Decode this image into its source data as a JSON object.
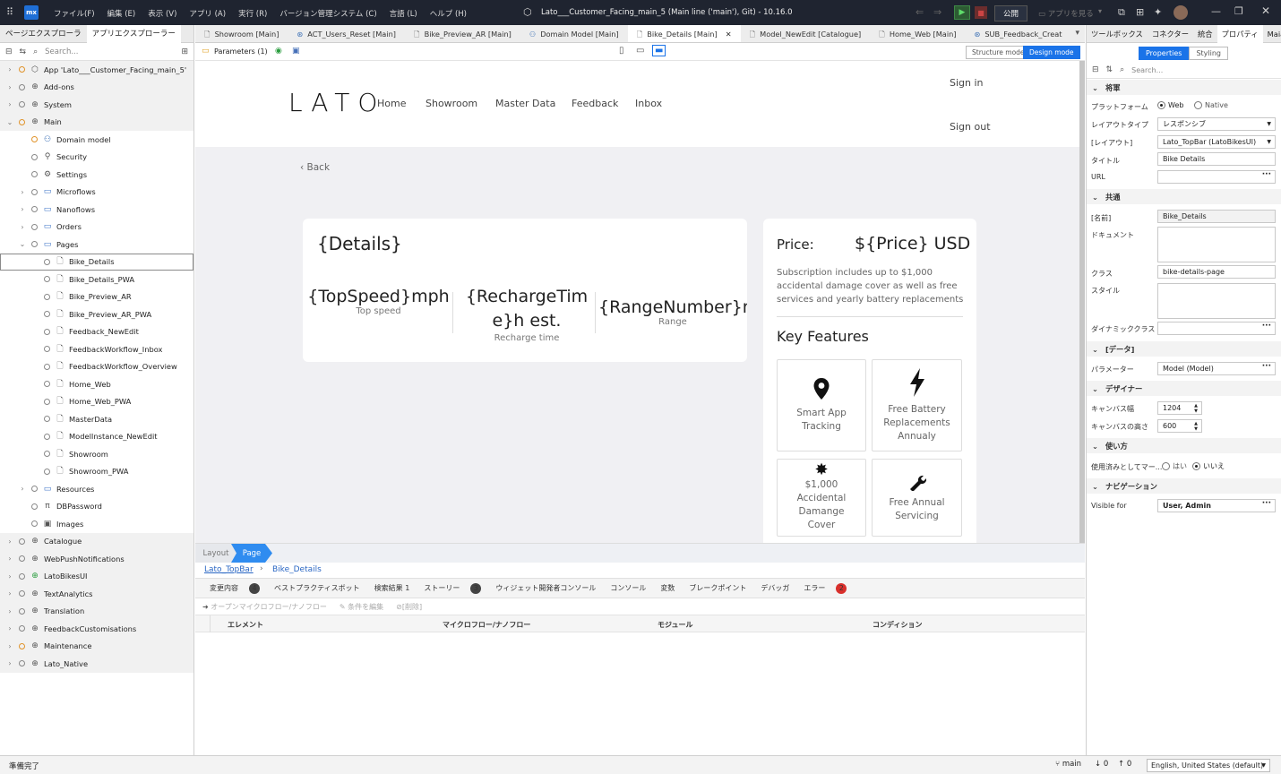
{
  "titlebar": {
    "menus": [
      "ファイル(F)",
      "編集 (E)",
      "表示 (V)",
      "アプリ (A)",
      "実行 (R)",
      "バージョン管理システム (C)",
      "言語 (L)",
      "ヘルプ (H)"
    ],
    "window_title": "Lato___Customer_Facing_main_5 (Main line ('main'), Git) - 10.16.0",
    "publish": "公開",
    "view_app": "アプリを見る",
    "logo": "mx"
  },
  "left": {
    "tabs": [
      "ページエクスプローラ",
      "アプリエクスプローラー"
    ],
    "search_placeholder": "Search...",
    "tree": [
      {
        "label": "App 'Lato___Customer_Facing_main_5'",
        "icon": "app-icon"
      },
      {
        "label": "Add-ons",
        "icon": "module-icon"
      },
      {
        "label": "System",
        "icon": "module-icon"
      },
      {
        "label": "Main",
        "icon": "module-icon"
      },
      {
        "label": "Domain model",
        "icon": "domain-model-icon"
      },
      {
        "label": "Security",
        "icon": "key-icon"
      },
      {
        "label": "Settings",
        "icon": "gear-icon"
      },
      {
        "label": "Microflows",
        "icon": "folder-icon"
      },
      {
        "label": "Nanoflows",
        "icon": "folder-icon"
      },
      {
        "label": "Orders",
        "icon": "folder-icon"
      },
      {
        "label": "Pages",
        "icon": "folder-icon"
      },
      {
        "label": "Bike_Details",
        "icon": "page-icon"
      },
      {
        "label": "Bike_Details_PWA",
        "icon": "page-icon"
      },
      {
        "label": "Bike_Preview_AR",
        "icon": "page-icon"
      },
      {
        "label": "Bike_Preview_AR_PWA",
        "icon": "page-icon"
      },
      {
        "label": "Feedback_NewEdit",
        "icon": "page-icon"
      },
      {
        "label": "FeedbackWorkflow_Inbox",
        "icon": "page-icon"
      },
      {
        "label": "FeedbackWorkflow_Overview",
        "icon": "page-icon"
      },
      {
        "label": "Home_Web",
        "icon": "page-icon"
      },
      {
        "label": "Home_Web_PWA",
        "icon": "page-icon"
      },
      {
        "label": "MasterData",
        "icon": "page-icon"
      },
      {
        "label": "ModelInstance_NewEdit",
        "icon": "page-icon"
      },
      {
        "label": "Showroom",
        "icon": "page-icon"
      },
      {
        "label": "Showroom_PWA",
        "icon": "page-icon"
      },
      {
        "label": "Resources",
        "icon": "folder-icon"
      },
      {
        "label": "DBPassword",
        "icon": "constant-icon"
      },
      {
        "label": "Images",
        "icon": "image-collection-icon"
      },
      {
        "label": "Catalogue",
        "icon": "module-icon"
      },
      {
        "label": "WebPushNotifications",
        "icon": "module-icon"
      },
      {
        "label": "LatoBikesUI",
        "icon": "module-icon"
      },
      {
        "label": "TextAnalytics",
        "icon": "module-icon"
      },
      {
        "label": "Translation",
        "icon": "module-icon"
      },
      {
        "label": "FeedbackCustomisations",
        "icon": "module-icon"
      },
      {
        "label": "Maintenance",
        "icon": "module-icon"
      },
      {
        "label": "Lato_Native",
        "icon": "module-icon"
      }
    ]
  },
  "doc_tabs": [
    {
      "label": "Showroom [Main]",
      "icon": "page-icon"
    },
    {
      "label": "ACT_Users_Reset [Main]",
      "icon": "microflow-icon"
    },
    {
      "label": "Bike_Preview_AR [Main]",
      "icon": "page-icon"
    },
    {
      "label": "Domain Model [Main]",
      "icon": "domain-model-icon"
    },
    {
      "label": "Bike_Details [Main]",
      "icon": "page-icon"
    },
    {
      "label": "Model_NewEdit [Catalogue]",
      "icon": "page-icon"
    },
    {
      "label": "Home_Web [Main]",
      "icon": "page-icon"
    },
    {
      "label": "SUB_Feedback_Creat",
      "icon": "microflow-icon"
    }
  ],
  "subbar": {
    "parameters": "Parameters (1)",
    "structure_mode": "Structure mode",
    "design_mode": "Design mode"
  },
  "site": {
    "logo": "LATO",
    "nav": [
      "Home",
      "Showroom",
      "Master Data",
      "Feedback",
      "Inbox"
    ],
    "sign_in": "Sign in",
    "sign_out": "Sign out",
    "back": "Back",
    "details": "{Details}",
    "stats": [
      {
        "value": "{TopSpeed}mph",
        "label": "Top speed"
      },
      {
        "value": "{RechargeTime}h est.",
        "label": "Recharge time"
      },
      {
        "value": "{RangeNumber}mi",
        "label": "Range"
      }
    ],
    "price_label": "Price:",
    "price_value": "${Price} USD",
    "price_note": "Subscription includes up to $1,000 accidental damage cover as well as free services and yearly battery replacements",
    "features_title": "Key Features",
    "features": [
      {
        "label": "Smart App Tracking",
        "icon": "map-pin-icon"
      },
      {
        "label": "Free Battery Replacements Annualy",
        "icon": "lightning-icon"
      },
      {
        "label": "$1,000 Accidental Damange Cover",
        "icon": "burst-icon"
      },
      {
        "label": "Free Annual Servicing",
        "icon": "wrench-icon"
      }
    ]
  },
  "bottom": {
    "crumb_layout": "Layout",
    "crumb_page": "Page",
    "link_layout": "Lato_TopBar",
    "link_page": "Bike_Details",
    "tabs": [
      {
        "label": "変更内容",
        "badge": "4"
      },
      {
        "label": "ベストプラクティスボット",
        "badge": ""
      },
      {
        "label": "検索結果 1",
        "badge": ""
      },
      {
        "label": "ストーリー",
        "badge": "3"
      },
      {
        "label": "ウィジェット開発者コンソール",
        "badge": ""
      },
      {
        "label": "コンソール",
        "badge": ""
      },
      {
        "label": "変数",
        "badge": ""
      },
      {
        "label": "ブレークポイント",
        "badge": ""
      },
      {
        "label": "デバッガ",
        "badge": ""
      },
      {
        "label": "エラー",
        "badge": "2"
      }
    ],
    "toolbar": [
      "オープンマイクロフロー/ナノフロー",
      "条件を編集",
      "[削除]"
    ],
    "columns": [
      "エレメント",
      "マイクロフロー/ナノフロー",
      "モジュール",
      "コンディション"
    ]
  },
  "right": {
    "tabs": [
      "ツールボックス",
      "コネクター",
      "統合",
      "プロパティ",
      "Maia"
    ],
    "toggle": [
      "Properties",
      "Styling"
    ],
    "search_placeholder": "Search...",
    "sections": {
      "general": "将軍",
      "common": "共通",
      "data": "[データ]",
      "designer": "デザイナー",
      "usage": "使い方",
      "navigation": "ナビゲーション"
    },
    "platform_label": "プラットフォーム",
    "platform_web": "Web",
    "platform_native": "Native",
    "layout_type_label": "レイアウトタイプ",
    "layout_type": "レスポンシブ",
    "layout_label": "[レイアウト]",
    "layout": "Lato_TopBar (LatoBikesUI)",
    "title_label": "タイトル",
    "title": "Bike Details",
    "url_label": "URL",
    "name_label": "[名前]",
    "name": "Bike_Details",
    "doc_label": "ドキュメント",
    "class_label": "クラス",
    "class": "bike-details-page",
    "style_label": "スタイル",
    "dynclass_label": "ダイナミッククラス",
    "param_label": "パラメーター",
    "param": "Model (Model)",
    "canvas_w_label": "キャンバス幅",
    "canvas_w": "1204",
    "canvas_h_label": "キャンバスの高さ",
    "canvas_h": "600",
    "used_label": "使用済みとしてマー...",
    "yes": "はい",
    "no": "いいえ",
    "visible_label": "Visible for",
    "visible": "User, Admin"
  },
  "status": {
    "ready": "準備完了",
    "branch": "main",
    "down": "0",
    "up": "0",
    "language": "English, United States (default)"
  }
}
